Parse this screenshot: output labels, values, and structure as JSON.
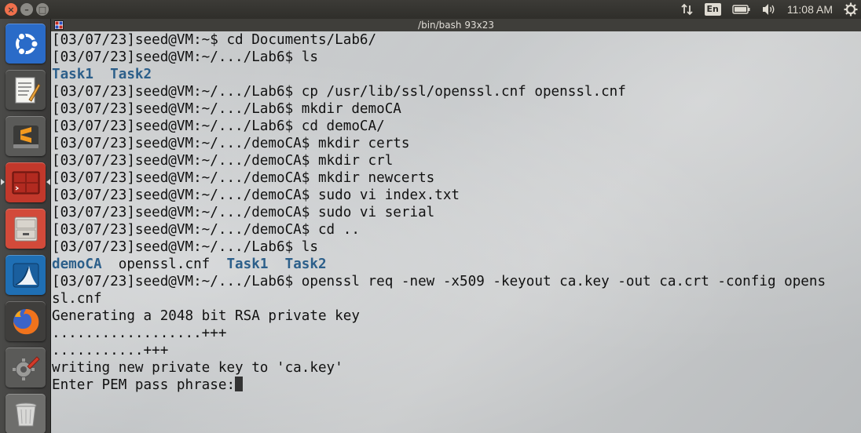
{
  "panel": {
    "language": "En",
    "clock": "11:08 AM",
    "window_buttons": [
      "close",
      "minimize",
      "maximize"
    ]
  },
  "launcher": {
    "items": [
      {
        "name": "ubuntu-dash",
        "icon": "ubuntu-logo-icon",
        "color": "#2a6bc8"
      },
      {
        "name": "text-editor",
        "icon": "text-editor-icon",
        "color": "#4d4d4b"
      },
      {
        "name": "sublime-text",
        "icon": "sublime-text-icon",
        "color": "#5a5a58"
      },
      {
        "name": "terminal",
        "icon": "terminal-icon",
        "color": "#c2382b"
      },
      {
        "name": "file-manager",
        "icon": "file-cabinet-icon",
        "color": "#d24a3a"
      },
      {
        "name": "wireshark",
        "icon": "wireshark-fin-icon",
        "color": "#1f6fb4"
      },
      {
        "name": "firefox",
        "icon": "firefox-icon",
        "color": "#e05a1c"
      },
      {
        "name": "system-settings",
        "icon": "settings-wrench-icon",
        "color": "#5a5a58"
      },
      {
        "name": "trash",
        "icon": "trash-icon",
        "color": "#6e6e6c"
      }
    ]
  },
  "terminal": {
    "title": "/bin/bash 93x23",
    "lines": [
      {
        "segments": [
          {
            "t": "[03/07/23]seed@VM:~$ cd Documents/Lab6/"
          }
        ]
      },
      {
        "segments": [
          {
            "t": "[03/07/23]seed@VM:~/.../Lab6$ ls"
          }
        ]
      },
      {
        "segments": [
          {
            "t": "Task1",
            "c": "dir"
          },
          {
            "t": "  "
          },
          {
            "t": "Task2",
            "c": "dir"
          }
        ]
      },
      {
        "segments": [
          {
            "t": "[03/07/23]seed@VM:~/.../Lab6$ cp /usr/lib/ssl/openssl.cnf openssl.cnf"
          }
        ]
      },
      {
        "segments": [
          {
            "t": "[03/07/23]seed@VM:~/.../Lab6$ mkdir demoCA"
          }
        ]
      },
      {
        "segments": [
          {
            "t": "[03/07/23]seed@VM:~/.../Lab6$ cd demoCA/"
          }
        ]
      },
      {
        "segments": [
          {
            "t": "[03/07/23]seed@VM:~/.../demoCA$ mkdir certs"
          }
        ]
      },
      {
        "segments": [
          {
            "t": "[03/07/23]seed@VM:~/.../demoCA$ mkdir crl"
          }
        ]
      },
      {
        "segments": [
          {
            "t": "[03/07/23]seed@VM:~/.../demoCA$ mkdir newcerts"
          }
        ]
      },
      {
        "segments": [
          {
            "t": "[03/07/23]seed@VM:~/.../demoCA$ sudo vi index.txt"
          }
        ]
      },
      {
        "segments": [
          {
            "t": "[03/07/23]seed@VM:~/.../demoCA$ sudo vi serial"
          }
        ]
      },
      {
        "segments": [
          {
            "t": "[03/07/23]seed@VM:~/.../demoCA$ cd .."
          }
        ]
      },
      {
        "segments": [
          {
            "t": "[03/07/23]seed@VM:~/.../Lab6$ ls"
          }
        ]
      },
      {
        "segments": [
          {
            "t": "demoCA",
            "c": "dir"
          },
          {
            "t": "  openssl.cnf  "
          },
          {
            "t": "Task1",
            "c": "dir"
          },
          {
            "t": "  "
          },
          {
            "t": "Task2",
            "c": "dir"
          }
        ]
      },
      {
        "segments": [
          {
            "t": "[03/07/23]seed@VM:~/.../Lab6$ openssl req -new -x509 -keyout ca.key -out ca.crt -config opens"
          }
        ]
      },
      {
        "segments": [
          {
            "t": "sl.cnf"
          }
        ]
      },
      {
        "segments": [
          {
            "t": "Generating a 2048 bit RSA private key"
          }
        ]
      },
      {
        "segments": [
          {
            "t": "..................+++"
          }
        ]
      },
      {
        "segments": [
          {
            "t": "...........+++"
          }
        ]
      },
      {
        "segments": [
          {
            "t": "writing new private key to 'ca.key'"
          }
        ]
      },
      {
        "segments": [
          {
            "t": "Enter PEM pass phrase:"
          }
        ],
        "cursor": true
      }
    ]
  }
}
